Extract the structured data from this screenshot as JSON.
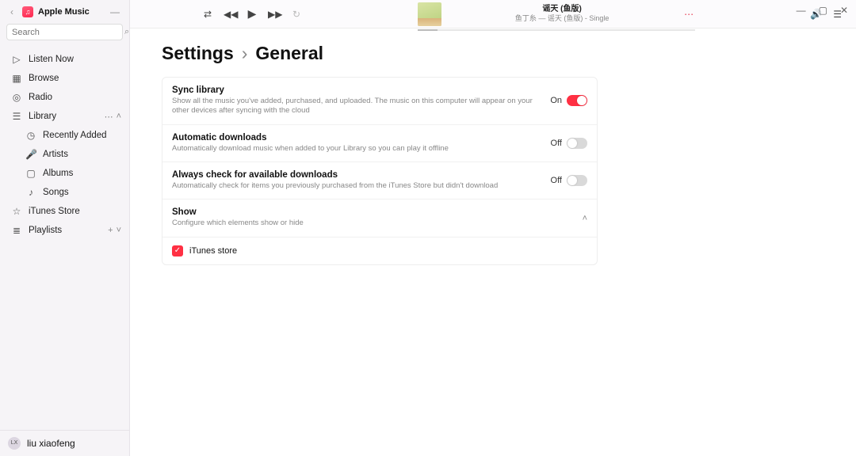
{
  "app": {
    "name": "Apple Music"
  },
  "search": {
    "placeholder": "Search"
  },
  "sidebar": {
    "items": [
      {
        "label": "Listen Now"
      },
      {
        "label": "Browse"
      },
      {
        "label": "Radio"
      },
      {
        "label": "Library"
      },
      {
        "label": "Recently Added"
      },
      {
        "label": "Artists"
      },
      {
        "label": "Albums"
      },
      {
        "label": "Songs"
      },
      {
        "label": "iTunes Store"
      },
      {
        "label": "Playlists"
      }
    ]
  },
  "user": {
    "name": "liu xiaofeng",
    "initials": "LX"
  },
  "nowplaying": {
    "title": "谣天 (鱼版)",
    "subtitle": "鱼丁糸 — 谣天 (鱼版) - Single"
  },
  "breadcrumb": {
    "root": "Settings",
    "sep": "›",
    "leaf": "General"
  },
  "settings": {
    "rows": [
      {
        "title": "Sync library",
        "sub": "Show all the music you've added, purchased, and uploaded. The music on this computer will appear on your other devices after syncing with the cloud",
        "state": "On"
      },
      {
        "title": "Automatic downloads",
        "sub": "Automatically download music when added to your Library so you can play it offline",
        "state": "Off"
      },
      {
        "title": "Always check for available downloads",
        "sub": "Automatically check for items you previously purchased from the iTunes Store but didn't download",
        "state": "Off"
      },
      {
        "title": "Show",
        "sub": "Configure which elements show or hide"
      }
    ],
    "show_item": {
      "label": "iTunes store"
    }
  }
}
